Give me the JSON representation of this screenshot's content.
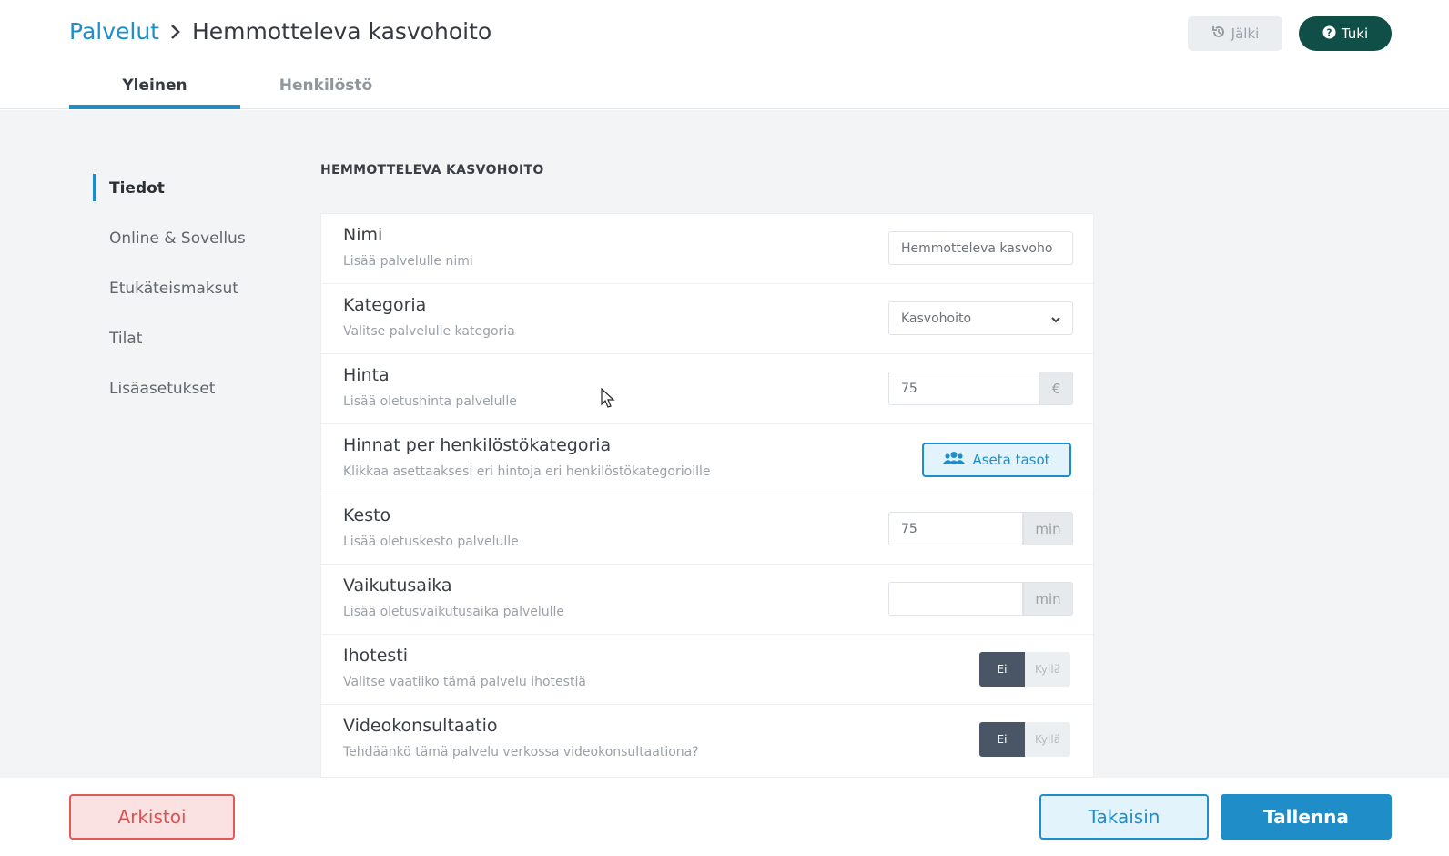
{
  "header": {
    "breadcrumb_root": "Palvelut",
    "breadcrumb_current": "Hemmotteleva kasvohoito",
    "history_button": "Jälki",
    "support_button": "Tuki"
  },
  "tabs": [
    {
      "label": "Yleinen",
      "active": true
    },
    {
      "label": "Henkilöstö",
      "active": false
    }
  ],
  "sidenav": [
    {
      "label": "Tiedot",
      "active": true
    },
    {
      "label": "Online & Sovellus"
    },
    {
      "label": "Etukäteismaksut"
    },
    {
      "label": "Tilat"
    },
    {
      "label": "Lisäasetukset"
    }
  ],
  "section_title": "HEMMOTTELEVA KASVOHOITO",
  "form": {
    "name": {
      "title": "Nimi",
      "subtitle": "Lisää palvelulle nimi",
      "value": "Hemmotteleva kasvoho"
    },
    "category": {
      "title": "Kategoria",
      "subtitle": "Valitse palvelulle kategoria",
      "value": "Kasvohoito"
    },
    "price": {
      "title": "Hinta",
      "subtitle": "Lisää oletushinta palvelulle",
      "value": "75",
      "unit": "€"
    },
    "staff_prices": {
      "title": "Hinnat per henkilöstökategoria",
      "subtitle": "Klikkaa asettaaksesi eri hintoja eri henkilöstökategorioille",
      "button": "Aseta tasot"
    },
    "duration": {
      "title": "Kesto",
      "subtitle": "Lisää oletuskesto palvelulle",
      "value": "75",
      "unit": "min"
    },
    "effect_time": {
      "title": "Vaikutusaika",
      "subtitle": "Lisää oletusvaikutusaika palvelulle",
      "value": "",
      "unit": "min"
    },
    "skin_test": {
      "title": "Ihotesti",
      "subtitle": "Valitse vaatiiko tämä palvelu ihotestiä",
      "no": "Ei",
      "yes": "Kyllä",
      "selected": "Ei"
    },
    "video": {
      "title": "Videokonsultaatio",
      "subtitle": "Tehdäänkö tämä palvelu verkossa videokonsultaationa?",
      "no": "Ei",
      "yes": "Kyllä",
      "selected": "Ei"
    }
  },
  "footer": {
    "archive_button": "Arkistoi",
    "back_button": "Takaisin",
    "save_button": "Tallenna"
  },
  "colors": {
    "primary": "#1f8ec8",
    "support": "#0f4f47",
    "danger": "#e05050",
    "toggle_selected": "#4a5566"
  }
}
